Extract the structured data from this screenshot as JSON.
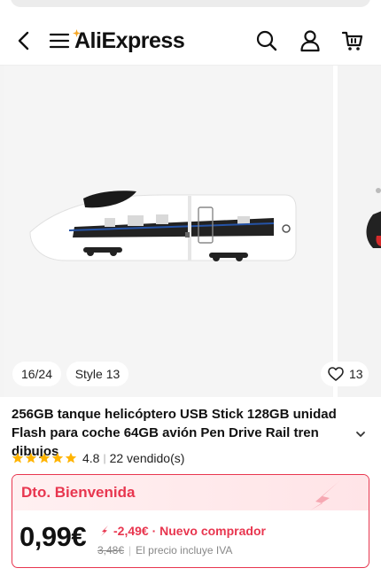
{
  "header": {
    "logo_text": "AliExpress",
    "icons": [
      "back-arrow-icon",
      "menu-icon",
      "search-icon",
      "account-icon",
      "cart-icon"
    ]
  },
  "gallery": {
    "page_indicator": "16/24",
    "style_label": "Style 13",
    "favorites_count": "13"
  },
  "product": {
    "title": "256GB tanque helicóptero USB Stick 128GB unidad Flash para coche 64GB avión Pen Drive Rail tren dibujos",
    "rating": "4.8",
    "sold": "22 vendido(s)",
    "stars_filled": 5
  },
  "promo": {
    "title": "Dto. Bienvenida",
    "price": "0,99€",
    "discount": "-2,49€ · Nuevo comprador",
    "old_price": "3,48€",
    "tax_note": "El precio incluye IVA"
  },
  "colors": {
    "accent": "#e8364f",
    "star": "#ffb400",
    "text": "#111111"
  }
}
